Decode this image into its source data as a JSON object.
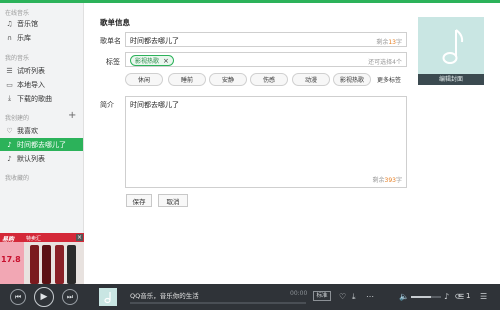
{
  "sidebar": {
    "section_online": "在线音乐",
    "online_items": [
      {
        "icon": "music-hall-icon",
        "label": "音乐馆"
      },
      {
        "icon": "headphones-icon",
        "label": "乐库"
      }
    ],
    "section_my": "我的音乐",
    "my_items": [
      {
        "icon": "list-icon",
        "label": "试听列表"
      },
      {
        "icon": "folder-icon",
        "label": "本地导入"
      },
      {
        "icon": "download-icon",
        "label": "下载的歌曲"
      }
    ],
    "section_created": "我创建的",
    "created_items": [
      {
        "icon": "heart-icon",
        "label": "我喜欢"
      },
      {
        "icon": "music-note-icon",
        "label": "时间都去哪儿了"
      },
      {
        "icon": "music-note-icon",
        "label": "默认列表"
      }
    ],
    "section_favorited": "我收藏的"
  },
  "ad": {
    "brand": "易购",
    "subtitle": "特卖汇",
    "price": "17.8"
  },
  "form": {
    "title": "歌单信息",
    "name_label": "歌单名",
    "name_value": "时间都去哪儿了",
    "name_hint_prefix": "剩余",
    "name_hint_count": "13",
    "name_hint_suffix": "字",
    "tags_label": "标签",
    "selected_tag": "影视热歌",
    "tags_hint": "还可选择4个",
    "tag_options": [
      "休闲",
      "睡前",
      "安静",
      "伤感",
      "动漫",
      "影视热歌"
    ],
    "more_tags": "更多标签",
    "intro_label": "简介",
    "intro_value": "时间都去哪儿了",
    "intro_hint_prefix": "剩余",
    "intro_hint_count": "393",
    "intro_hint_suffix": "字",
    "save": "保存",
    "cancel": "取消"
  },
  "cover": {
    "caption": "编辑封面"
  },
  "player": {
    "track": "QQ音乐，音乐你的生活",
    "time": "00:00",
    "quality": "标准",
    "count": "1"
  },
  "colors": {
    "accent": "#2cb25a",
    "hint_number": "#e67e22",
    "cover_bg": "#c9e6e3",
    "player_bg": "#2f3338"
  }
}
